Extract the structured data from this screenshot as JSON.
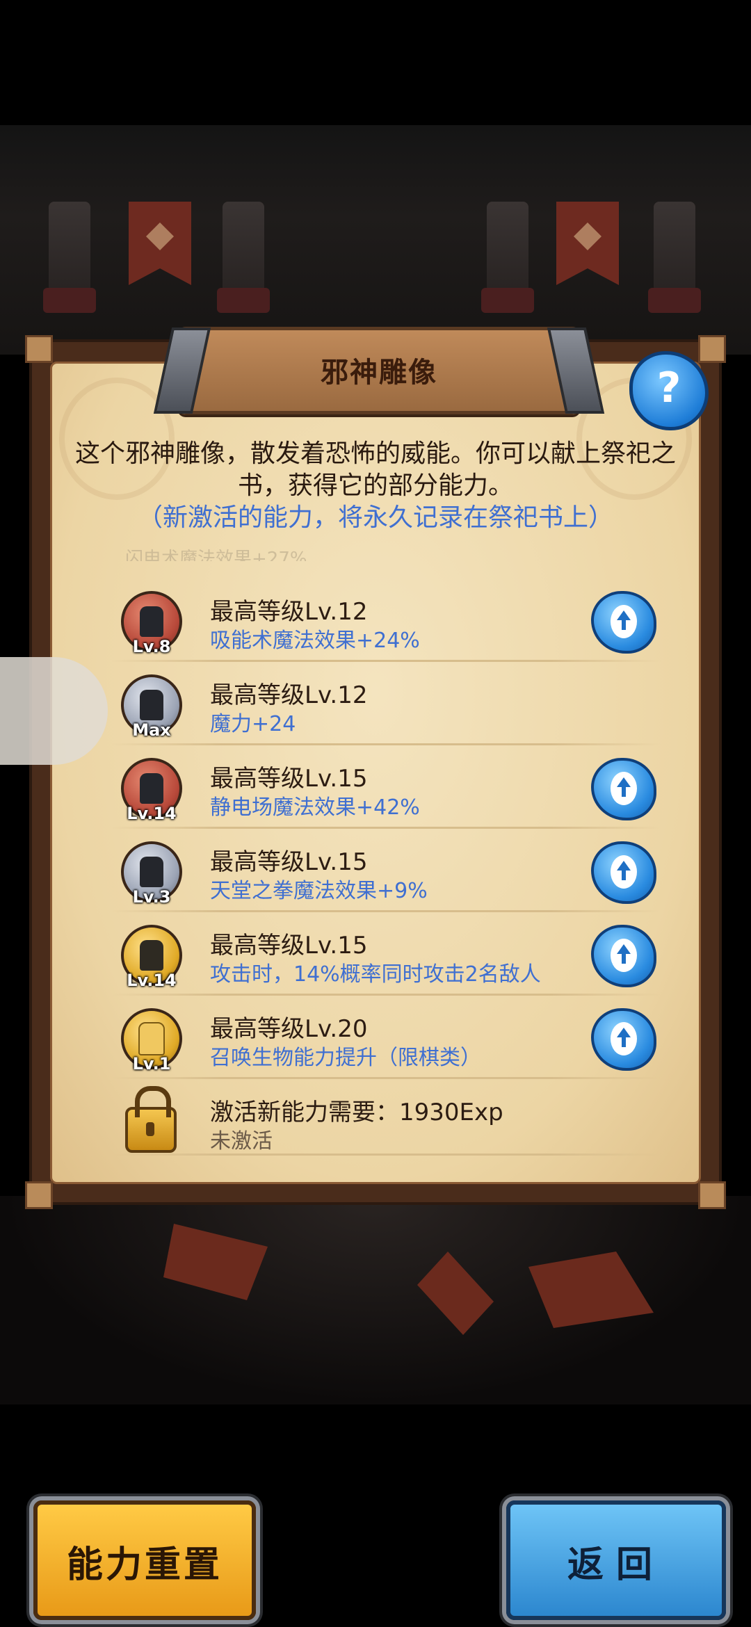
{
  "panel": {
    "title": "邪神雕像",
    "help_symbol": "?",
    "description": "这个邪神雕像，散发着恐怖的威能。你可以献上祭祀之书，获得它的部分能力。",
    "note": "（新激活的能力，将永久记录在祭祀书上）",
    "faded_row_text": "闪电术魔法效果+27%"
  },
  "abilities": [
    {
      "title": "最高等级Lv.12",
      "effect": "吸能术魔法效果+24%",
      "level": "Lv.8",
      "medal": "red",
      "upgradable": true
    },
    {
      "title": "最高等级Lv.12",
      "effect": "魔力+24",
      "level": "Max",
      "medal": "silver",
      "upgradable": false
    },
    {
      "title": "最高等级Lv.15",
      "effect": "静电场魔法效果+42%",
      "level": "Lv.14",
      "medal": "red",
      "upgradable": true
    },
    {
      "title": "最高等级Lv.15",
      "effect": "天堂之拳魔法效果+9%",
      "level": "Lv.3",
      "medal": "silver",
      "upgradable": true
    },
    {
      "title": "最高等级Lv.15",
      "effect": "攻击时，14%概率同时攻击2名敌人",
      "level": "Lv.14",
      "medal": "gold",
      "upgradable": true
    },
    {
      "title": "最高等级Lv.20",
      "effect": "召唤生物能力提升（限棋类）",
      "level": "Lv.1",
      "medal": "gold-light",
      "upgradable": true
    }
  ],
  "locked": {
    "title": "激活新能力需要：1930Exp",
    "status": "未激活"
  },
  "buttons": {
    "reset": "能力重置",
    "back": "返回"
  },
  "colors": {
    "note_blue": "#3f6fd1",
    "reset_gold": "#ffca45",
    "back_blue": "#2c87cf"
  }
}
